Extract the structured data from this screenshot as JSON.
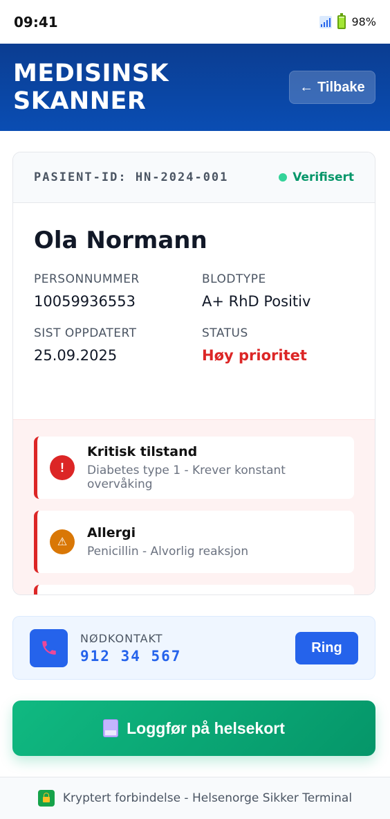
{
  "status_bar": {
    "time": "09:41",
    "battery": "98%"
  },
  "header": {
    "title": "MEDISINSK SKANNER",
    "back_label": "Tilbake",
    "back_arrow": "←"
  },
  "patient": {
    "id_label": "PASIENT-ID: HN-2024-001",
    "verified": "Verifisert",
    "name": "Ola Normann",
    "fields": {
      "personnummer_label": "PERSONNUMMER",
      "personnummer": "10059936553",
      "blodtype_label": "BLODTYPE",
      "blodtype": "A+ RhD Positiv",
      "updated_label": "SIST OPPDATERT",
      "updated": "25.09.2025",
      "status_label": "STATUS",
      "status": "Høy prioritet"
    }
  },
  "alerts": [
    {
      "icon": "!",
      "title": "Kritisk tilstand",
      "detail": "Diabetes type 1 - Krever konstant overvåking"
    },
    {
      "icon": "⚠",
      "title": "Allergi",
      "detail": "Penicillin - Alvorlig reaksjon"
    }
  ],
  "emergency_contact": {
    "label": "NØDKONTAKT",
    "number": "912 34 567",
    "call_label": "Ring"
  },
  "log_button": {
    "label": "Loggfør på helsekort"
  },
  "footer": {
    "text": "Kryptert forbindelse - Helsenorge Sikker Terminal"
  },
  "colors": {
    "primary": "#0a4db3",
    "danger": "#dc2626",
    "success": "#10b981",
    "accent": "#2563eb"
  }
}
